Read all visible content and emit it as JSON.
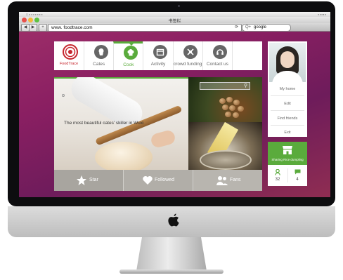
{
  "browser": {
    "window_title": "书签栏",
    "url": "www. foodtrace.com",
    "search_text": "google",
    "search_prefix": "Q+",
    "back_icon": "back-arrow-icon",
    "forward_icon": "forward-arrow-icon",
    "add_icon": "plus-icon",
    "reload_icon": "reload-icon"
  },
  "site": {
    "logo_text": "FoodTrace",
    "nav": [
      {
        "label": "Cates",
        "icon": "cupcake-icon"
      },
      {
        "label": "Cook",
        "icon": "chef-hat-icon",
        "active": true
      },
      {
        "label": "Activity",
        "icon": "calendar-icon"
      },
      {
        "label": "crowd funding",
        "icon": "crowd-funding-icon"
      },
      {
        "label": "Contact us",
        "icon": "headset-icon"
      }
    ],
    "hero_caption": "The most beautiful cates' skiller in Wuxi",
    "social": [
      {
        "label": "Star",
        "icon": "star-icon"
      },
      {
        "label": "Followed",
        "icon": "heart-icon"
      },
      {
        "label": "Fans",
        "icon": "people-icon"
      }
    ],
    "sidebar": {
      "items": [
        "My home",
        "Edit",
        "Find friends",
        "Exit"
      ]
    },
    "shop_label": "Sharing Rice dumpling",
    "stats": [
      {
        "icon": "user-icon",
        "value": "32"
      },
      {
        "icon": "message-icon",
        "value": "4"
      }
    ]
  },
  "colors": {
    "accent": "#5aab3c",
    "background": "#8a1f62",
    "logo_red": "#c6262e"
  }
}
